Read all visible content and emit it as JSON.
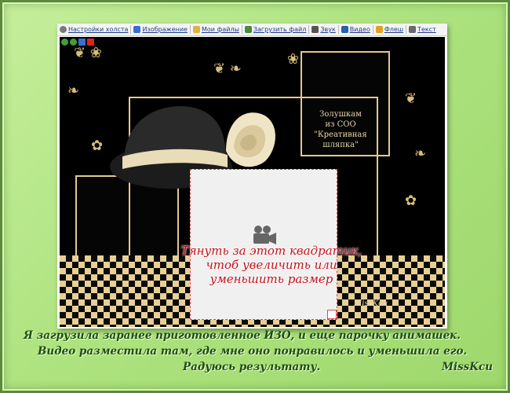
{
  "toolbar": {
    "items": [
      {
        "label": "Настройки холста",
        "icon": "gear-icon",
        "color": "#7a7a7a"
      },
      {
        "label": "Изображение",
        "icon": "image-icon",
        "color": "#3a6fd0"
      },
      {
        "label": "Мои файлы",
        "icon": "folder-icon",
        "color": "#e0b240"
      },
      {
        "label": "Загрузить файл",
        "icon": "upload-icon",
        "color": "#4a8a3a"
      },
      {
        "label": "Звук",
        "icon": "speaker-icon",
        "color": "#555555"
      },
      {
        "label": "Видео",
        "icon": "video-icon",
        "color": "#2b5fb0"
      },
      {
        "label": "Флеш",
        "icon": "flash-icon",
        "color": "#e0a020"
      },
      {
        "label": "Текст",
        "icon": "text-icon",
        "color": "#6a6a6a"
      }
    ]
  },
  "canvas": {
    "caption_lines": [
      "Золушкам",
      "из СОО",
      "\"Креативная шляпка\""
    ],
    "hint_lines": [
      "Тянуть за этот квадратик,",
      "чтоб увеличить или",
      "уменьшить размер"
    ],
    "signature": "MissKcu"
  },
  "footer": {
    "line1": "Я загрузила заранее приготовленное ИЗО, и еще парочку анимашек.",
    "line2": "Видео разместила там, где мне оно понравилось и уменьшила его.",
    "line3": "Радуюсь результату.",
    "signature": "MissKcu"
  },
  "colors": {
    "frame_bg": "#aee37f",
    "canvas_bg": "#000000",
    "ornament": "#d8bd7c",
    "hint_text": "#c8101c",
    "footer_text": "#1e4d12"
  }
}
